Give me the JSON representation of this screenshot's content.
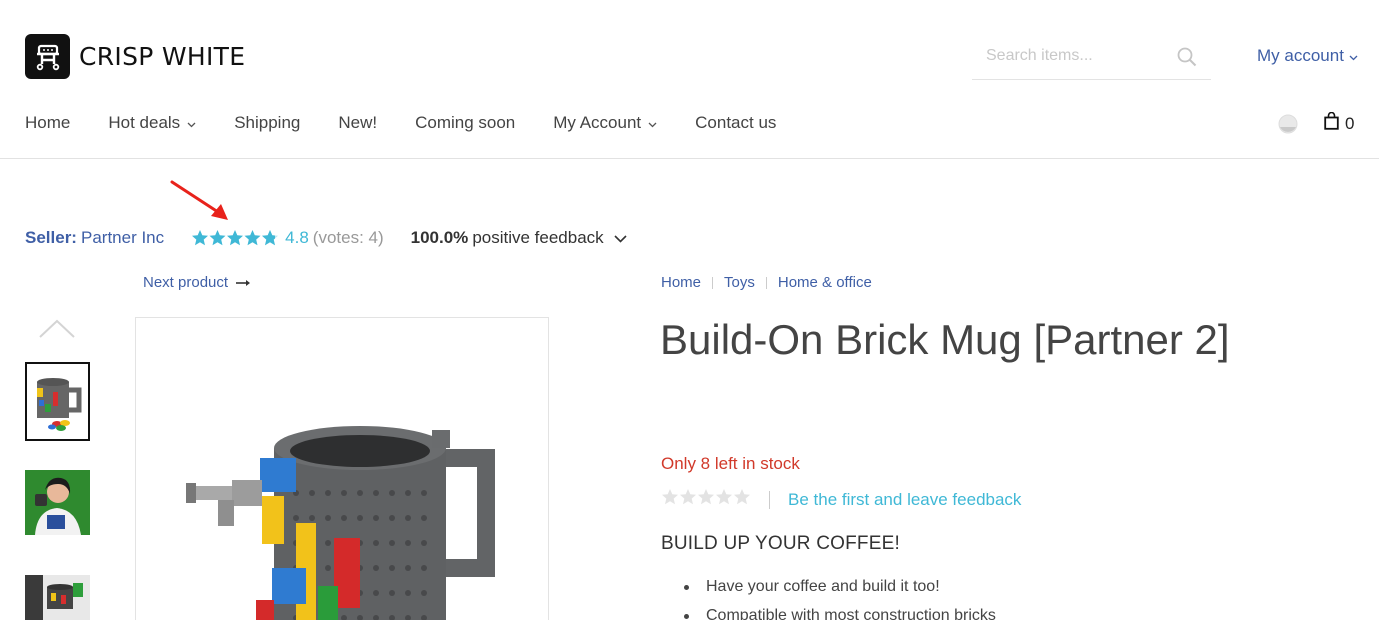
{
  "brand": {
    "name": "CRISP WHITE",
    "logo_icon": "cart-robot-logo-icon"
  },
  "search": {
    "placeholder": "Search items..."
  },
  "account": {
    "label": "My account"
  },
  "nav": {
    "items": [
      {
        "label": "Home",
        "has_dropdown": false
      },
      {
        "label": "Hot deals",
        "has_dropdown": true
      },
      {
        "label": "Shipping",
        "has_dropdown": false
      },
      {
        "label": "New!",
        "has_dropdown": false
      },
      {
        "label": "Coming soon",
        "has_dropdown": false
      },
      {
        "label": "My Account",
        "has_dropdown": true
      },
      {
        "label": "Contact us",
        "has_dropdown": false
      }
    ],
    "cart_count": "0"
  },
  "seller": {
    "label": "Seller:",
    "name": "Partner Inc",
    "rating": "4.8",
    "votes": "(votes: 4)",
    "feedback_percent": "100.0%",
    "feedback_text": "positive feedback",
    "star_color": "#3fb8d6"
  },
  "gallery": {
    "next_label": "Next product"
  },
  "breadcrumb": [
    "Home",
    "Toys",
    "Home & office"
  ],
  "product": {
    "title": "Build-On Brick Mug [Partner 2]",
    "stock": "Only 8 left in stock",
    "rating_stars": 0,
    "first_feedback": "Be the first and leave feedback",
    "subheading": "BUILD UP YOUR COFFEE!",
    "features": [
      "Have your coffee and build it too!",
      "Compatible with most construction bricks"
    ]
  },
  "colors": {
    "link": "#3f5fa6",
    "accent": "#3fb8d6",
    "stock": "#d1392a",
    "annotation": "#e8221b"
  }
}
